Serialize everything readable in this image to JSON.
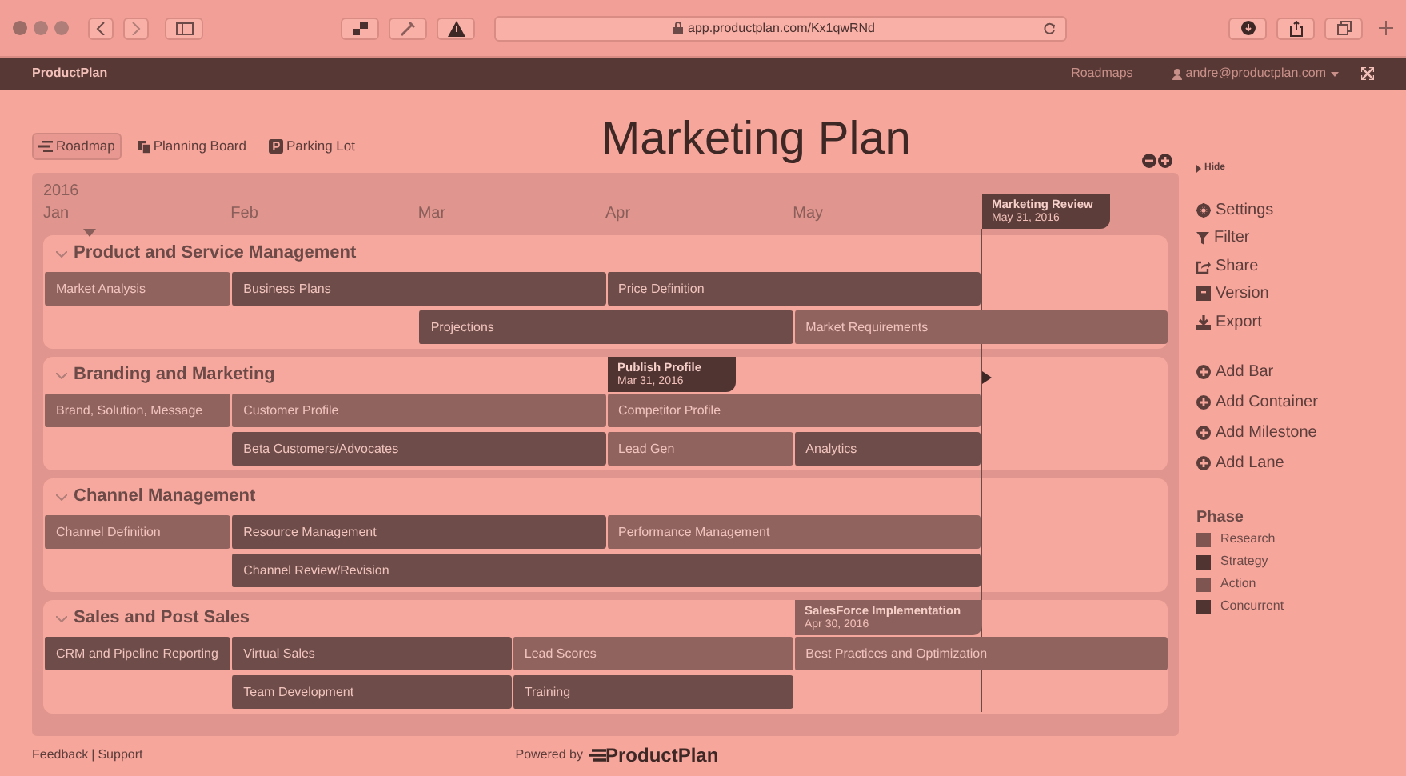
{
  "browser": {
    "url": "app.productplan.com/Kx1qwRNd"
  },
  "app_bar": {
    "brand": "ProductPlan",
    "nav": "Roadmaps",
    "user": "andre@productplan.com"
  },
  "view_tabs": [
    {
      "label": "Roadmap",
      "kind": "roadmap",
      "selected": true
    },
    {
      "label": "Planning Board",
      "kind": "board",
      "selected": false
    },
    {
      "label": "Parking Lot",
      "kind": "lot",
      "selected": false
    }
  ],
  "title": "Marketing Plan",
  "timeline": {
    "year": "2016",
    "months": [
      "Jan",
      "Feb",
      "Mar",
      "Apr",
      "May"
    ],
    "milestones": [
      {
        "title": "Marketing Review",
        "date": "May 31, 2016",
        "color": "#5c3d3a"
      },
      {
        "title": "Publish Profile",
        "date": "Mar 31, 2016",
        "color": "#4f3432"
      },
      {
        "title": "SalesForce Implementation",
        "date": "Apr 30, 2016",
        "color": "#8c605c"
      }
    ],
    "lanes": [
      {
        "title": "Product and Service Management",
        "rows": [
          [
            {
              "label": "Market Analysis",
              "color": "#91635f"
            },
            {
              "label": "Business Plans",
              "color": "#6d4c49"
            },
            {
              "label": "Price Definition",
              "color": "#6d4c49"
            }
          ],
          [
            {
              "label": "Projections",
              "color": "#6d4c49"
            },
            {
              "label": "Market Requirements",
              "color": "#91635f"
            }
          ]
        ]
      },
      {
        "title": "Branding and Marketing",
        "rows": [
          [
            {
              "label": "Brand, Solution, Message",
              "color": "#91635f"
            },
            {
              "label": "Customer Profile",
              "color": "#91635f"
            },
            {
              "label": "Competitor Profile",
              "color": "#91635f"
            }
          ],
          [
            "",
            {
              "label": "Beta Customers/Advocates",
              "color": "#6d4c49"
            },
            {
              "label": "Lead Gen",
              "color": "#91635f"
            },
            {
              "label": "Analytics",
              "color": "#6d4c49"
            }
          ]
        ]
      },
      {
        "title": "Channel Management",
        "rows": [
          [
            {
              "label": "Channel Definition",
              "color": "#91635f"
            },
            {
              "label": "Resource Management",
              "color": "#6d4c49"
            },
            {
              "label": "Performance Management",
              "color": "#91635f"
            }
          ],
          [
            "",
            {
              "label": "Channel Review/Revision",
              "color": "#6d4c49"
            }
          ]
        ]
      },
      {
        "title": "Sales and Post Sales",
        "rows": [
          [
            {
              "label": "CRM and Pipeline Reporting",
              "color": "#6d4c49"
            },
            {
              "label": "Virtual Sales",
              "color": "#6d4c49"
            },
            {
              "label": "Lead Scores",
              "color": "#91635f"
            },
            {
              "label": "Best Practices and Optimization",
              "color": "#91635f"
            }
          ],
          [
            "",
            {
              "label": "Team Development",
              "color": "#6d4c49"
            },
            {
              "label": "Training",
              "color": "#6d4c49"
            }
          ]
        ]
      }
    ]
  },
  "sidebar": {
    "hide": "Hide",
    "actions": [
      {
        "label": "Settings",
        "kind": "gear"
      },
      {
        "label": "Filter",
        "kind": "filter"
      },
      {
        "label": "Share",
        "kind": "share"
      },
      {
        "label": "Version",
        "kind": "version"
      },
      {
        "label": "Export",
        "kind": "export"
      }
    ],
    "add_actions": [
      "Add Bar",
      "Add Container",
      "Add Milestone",
      "Add Lane"
    ],
    "legend_title": "Phase",
    "legend": [
      {
        "label": "Research",
        "color": "#7f5551"
      },
      {
        "label": "Strategy",
        "color": "#4f3432"
      },
      {
        "label": "Action",
        "color": "#7f5551"
      },
      {
        "label": "Concurrent",
        "color": "#4f3432"
      }
    ]
  },
  "footer": {
    "links": [
      "Feedback",
      "Support"
    ],
    "separator": "|",
    "powered": "Powered by",
    "logo": "ProductPlan"
  }
}
